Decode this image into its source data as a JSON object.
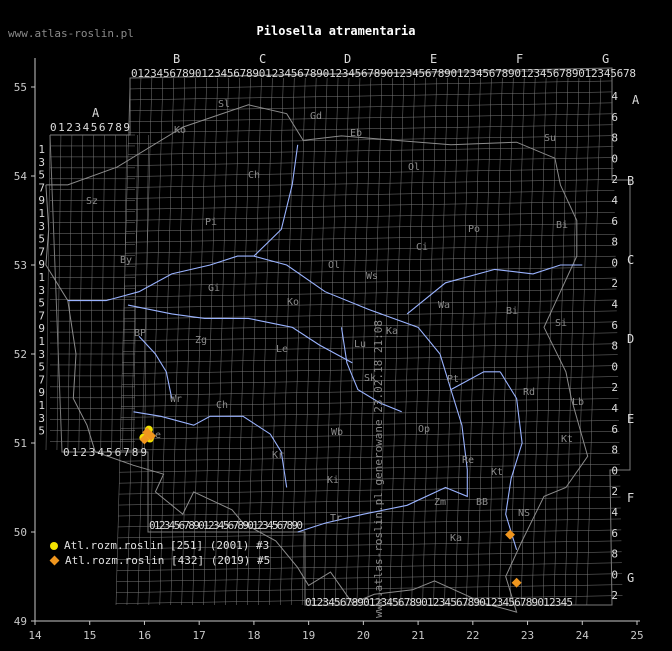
{
  "site_label": "www.atlas-roslin.pl",
  "title": "Pilosella atramentaria",
  "generated_label": "www.atlas-roslin.pl generowane 23.02.18 21:08",
  "axes": {
    "x_ticks": [
      "14",
      "15",
      "16",
      "17",
      "18",
      "19",
      "20",
      "21",
      "22",
      "23",
      "24",
      "25"
    ],
    "y_ticks": [
      "49",
      "50",
      "51",
      "52",
      "53",
      "54",
      "55"
    ]
  },
  "grid_letters": {
    "top": [
      "A",
      "B",
      "C",
      "D",
      "E",
      "F",
      "G"
    ],
    "right": [
      "A",
      "B",
      "C",
      "D",
      "E",
      "F",
      "G"
    ]
  },
  "grid_digits": {
    "top_row": "0123456789012345678901234567890123456789012345678901234567890123456789012345678",
    "a_row": "0123456789",
    "bottom_row_left": "0123456789012345678901234567890",
    "bottom_row_right": "0123456789012345678901234567890123456789012345",
    "left_column": [
      "1",
      "3",
      "5",
      "7",
      "9",
      "1",
      "3",
      "5",
      "7",
      "9",
      "1",
      "3",
      "5",
      "7",
      "9",
      "1",
      "3",
      "5",
      "7",
      "9",
      "1",
      "3",
      "5",
      "7",
      "9"
    ],
    "right_column": [
      "4",
      "6",
      "8",
      "0",
      "2",
      "4",
      "6",
      "8",
      "0",
      "2",
      "4",
      "6",
      "8",
      "0",
      "2",
      "4",
      "6",
      "8",
      "0",
      "2",
      "4",
      "6",
      "8",
      "0",
      "2"
    ]
  },
  "region_labels": [
    "Sl",
    "Ko",
    "Gd",
    "Eb",
    "Su",
    "Ch",
    "Ol",
    "Sz",
    "Pi",
    "Bi",
    "Ci",
    "Ol",
    "Ws",
    "Po",
    "By",
    "Gi",
    "Wa",
    "Ko",
    "Bi",
    "Si",
    "BP",
    "Zg",
    "Le",
    "Ka",
    "Lu",
    "Sk",
    "Pt",
    "Rd",
    "Lb",
    "Ch",
    "Wr",
    "Le",
    "Wb",
    "Op",
    "Kt",
    "Ki",
    "Zm",
    "Kt",
    "Tr",
    "Ka",
    "BB",
    "NS",
    "Re",
    "Kr"
  ],
  "legend": [
    {
      "label": "Atl.rozm.roslin [251] (2001) #3",
      "color": "#f2e200",
      "shape": "circle"
    },
    {
      "label": "Atl.rozm.roslin [432] (2019) #5",
      "color": "#f0961e",
      "shape": "diamond"
    }
  ],
  "colors": {
    "grid": "#7a7a7a",
    "border": "#8c8c8c",
    "river": "#9ab3ff",
    "axis": "#c8c8c8",
    "text": "#dcdcdc"
  },
  "points": [
    {
      "lon": 16.08,
      "lat": 51.15,
      "series": 0
    },
    {
      "lon": 15.98,
      "lat": 51.06,
      "series": 0
    },
    {
      "lon": 16.1,
      "lat": 51.05,
      "series": 0
    },
    {
      "lon": 16.12,
      "lat": 51.08,
      "series": 1
    },
    {
      "lon": 16.05,
      "lat": 51.12,
      "series": 1
    },
    {
      "lon": 22.68,
      "lat": 49.97,
      "series": 1
    },
    {
      "lon": 22.8,
      "lat": 49.43,
      "series": 1
    },
    {
      "lon": 16.0,
      "lat": 51.04,
      "series": 1
    }
  ]
}
